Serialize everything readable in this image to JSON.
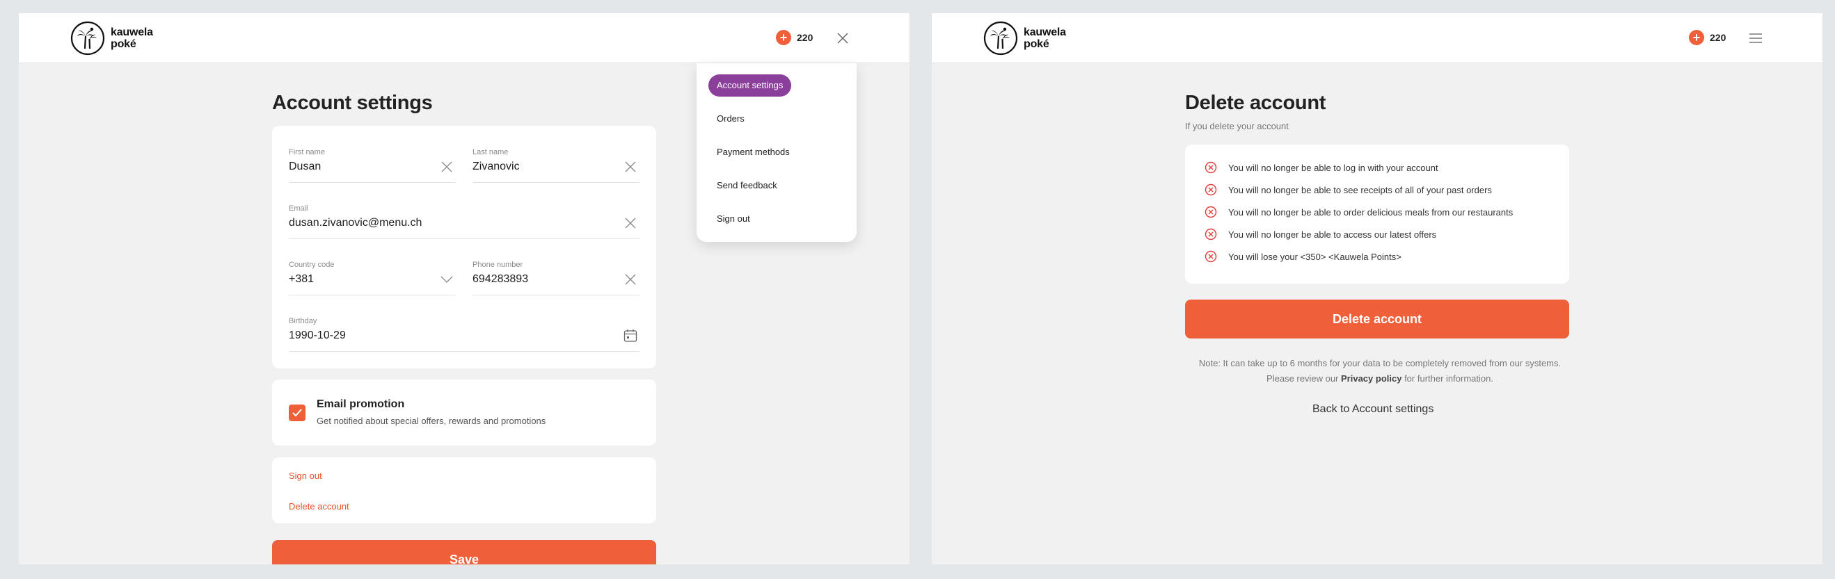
{
  "brand": {
    "line1": "kauwela",
    "line2": "poké"
  },
  "points": {
    "icon": "plus-icon",
    "value": "220"
  },
  "left": {
    "title": "Account settings",
    "fields": {
      "first_name": {
        "label": "First name",
        "value": "Dusan"
      },
      "last_name": {
        "label": "Last name",
        "value": "Zivanovic"
      },
      "email": {
        "label": "Email",
        "value": "dusan.zivanovic@menu.ch"
      },
      "country_code": {
        "label": "Country code",
        "value": "+381"
      },
      "phone": {
        "label": "Phone number",
        "value": "694283893"
      },
      "birthday": {
        "label": "Birthday",
        "value": "1990-10-29"
      }
    },
    "promotion": {
      "title": "Email promotion",
      "description": "Get notified about special offers, rewards and promotions",
      "checked": true
    },
    "links": {
      "sign_out": "Sign out",
      "delete_account": "Delete account"
    },
    "save_label": "Save"
  },
  "menu": {
    "items": [
      {
        "label": "Account settings",
        "active": true
      },
      {
        "label": "Orders",
        "active": false
      },
      {
        "label": "Payment methods",
        "active": false
      },
      {
        "label": "Send feedback",
        "active": false
      },
      {
        "label": "Sign out",
        "active": false
      }
    ]
  },
  "right": {
    "title": "Delete account",
    "subtitle": "If you delete your account",
    "reasons": [
      "You will no longer be able to log in with your account",
      "You will no longer be able to see receipts of all of your past orders",
      "You will no longer be able to order delicious meals from our restaurants",
      "You will no longer be able to access our latest offers",
      "You will lose your <350> <Kauwela Points>"
    ],
    "delete_button": "Delete account",
    "note_line1": "Note: It can take up to 6 months for your data to be completely removed from our systems.",
    "note_line2_prefix": "Please review our ",
    "note_link": "Privacy policy",
    "note_line2_suffix": " for further information.",
    "back_link": "Back to Account settings"
  },
  "colors": {
    "accent": "#ee5f3a",
    "menu_active": "#8a3f9b",
    "panel_bg": "#f1f1f2",
    "page_bg": "#e4e7ea"
  }
}
